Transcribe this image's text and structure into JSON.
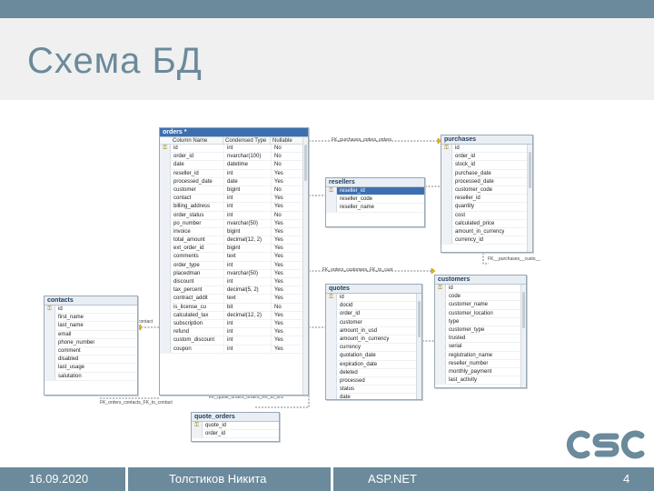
{
  "slide": {
    "title": "Схема БД"
  },
  "footer": {
    "date": "16.09.2020",
    "author": "Толстиков Никита",
    "subject": "ASP.NET",
    "page": "4"
  },
  "logo": {
    "name": "csc-logo",
    "text": "CSC"
  },
  "colors": {
    "accent": "#6b8a9c",
    "title_band": "#f0f0f0",
    "logo": "#6b8a9c",
    "selection": "#3c6fb0"
  },
  "tables": {
    "orders": {
      "name": "orders *",
      "column_headers": [
        "Column Name",
        "Condensed Type",
        "Nullable"
      ],
      "rows": [
        [
          "id",
          "int",
          "No"
        ],
        [
          "order_id",
          "nvarchar(100)",
          "No"
        ],
        [
          "date",
          "datetime",
          "No"
        ],
        [
          "reseller_id",
          "int",
          "Yes"
        ],
        [
          "processed_date",
          "date",
          "Yes"
        ],
        [
          "customer",
          "bigint",
          "No"
        ],
        [
          "contact",
          "int",
          "Yes"
        ],
        [
          "billing_address",
          "int",
          "Yes"
        ],
        [
          "order_status",
          "int",
          "No"
        ],
        [
          "po_number",
          "nvarchar(50)",
          "Yes"
        ],
        [
          "invoice",
          "bigint",
          "Yes"
        ],
        [
          "total_amount",
          "decimal(12, 2)",
          "Yes"
        ],
        [
          "ext_order_id",
          "bigint",
          "Yes"
        ],
        [
          "comments",
          "text",
          "Yes"
        ],
        [
          "order_type",
          "int",
          "Yes"
        ],
        [
          "placedman",
          "nvarchar(50)",
          "Yes"
        ],
        [
          "discount",
          "int",
          "Yes"
        ],
        [
          "tax_percent",
          "decimal(5, 2)",
          "Yes"
        ],
        [
          "contract_addit",
          "text",
          "Yes"
        ],
        [
          "is_license_cu",
          "bit",
          "No"
        ],
        [
          "calculated_tax",
          "decimal(12, 2)",
          "Yes"
        ],
        [
          "subscription",
          "int",
          "Yes"
        ],
        [
          "refund",
          "int",
          "Yes"
        ],
        [
          "custom_discount",
          "int",
          "Yes"
        ],
        [
          "coupon",
          "int",
          "Yes"
        ]
      ]
    },
    "purchases": {
      "name": "purchases",
      "rows": [
        "id",
        "order_id",
        "stock_id",
        "purchase_date",
        "processed_date",
        "customer_code",
        "reseller_id",
        "quantity",
        "cost",
        "calculated_price",
        "amount_in_currency",
        "currency_id"
      ]
    },
    "resellers": {
      "name": "resellers",
      "rows": [
        "reseller_id",
        "reseller_code",
        "reseller_name"
      ]
    },
    "customers": {
      "name": "customers",
      "rows": [
        "id",
        "code",
        "customer_name",
        "customer_location",
        "type",
        "customer_type",
        "trusted",
        "serial",
        "registration_name",
        "reseller_number",
        "monthly_payment",
        "last_activity"
      ]
    },
    "quotes": {
      "name": "quotes",
      "rows": [
        "id",
        "docid",
        "order_id",
        "customer",
        "amount_in_usd",
        "amount_in_currency",
        "currency",
        "quotation_date",
        "expiration_date",
        "deleted",
        "processed",
        "status",
        "date"
      ]
    },
    "contacts": {
      "name": "contacts",
      "rows": [
        "id",
        "first_name",
        "last_name",
        "email",
        "phone_number",
        "comment",
        "disabled",
        "last_usage",
        "salutation"
      ]
    },
    "quote_orders": {
      "name": "quote_orders",
      "rows": [
        "quote_id",
        "order_id"
      ]
    }
  },
  "relations": {
    "orders_purchases": "FK_purchases_orders_orders",
    "purchases_label": "FK__purchases__custo__",
    "orders_customers": "FK_orders_customers_FK_to_cust",
    "contacts_label": "contact",
    "orders_contacts": "FK_orders_contacts_FK_to_contact",
    "quote_orders_label": "FK_quote_orders_orders_FK_to_ord"
  }
}
